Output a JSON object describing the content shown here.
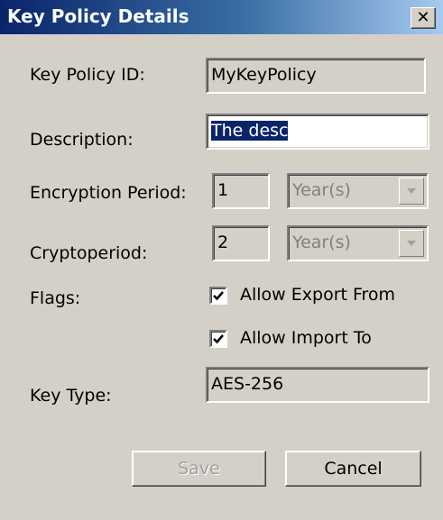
{
  "window": {
    "title": "Key Policy Details",
    "close_glyph": "✕"
  },
  "form": {
    "key_policy_id": {
      "label": "Key Policy ID:",
      "value": "MyKeyPolicy"
    },
    "description": {
      "label": "Description:",
      "value": "The desc"
    },
    "encryption_period": {
      "label": "Encryption Period:",
      "value": "1",
      "unit": "Year(s)"
    },
    "cryptoperiod": {
      "label": "Cryptoperiod:",
      "value": "2",
      "unit": "Year(s)"
    },
    "flags": {
      "label": "Flags:",
      "options": [
        {
          "label": "Allow Export From",
          "checked": true
        },
        {
          "label": "Allow Import To",
          "checked": true
        }
      ]
    },
    "key_type": {
      "label": "Key Type:",
      "value": "AES-256"
    }
  },
  "buttons": {
    "save": "Save",
    "cancel": "Cancel"
  },
  "colors": {
    "title_gradient_start": "#0a246a",
    "title_gradient_end": "#a6caf0",
    "dialog_face": "#d4d0c8",
    "selection_highlight": "#0a246a"
  }
}
